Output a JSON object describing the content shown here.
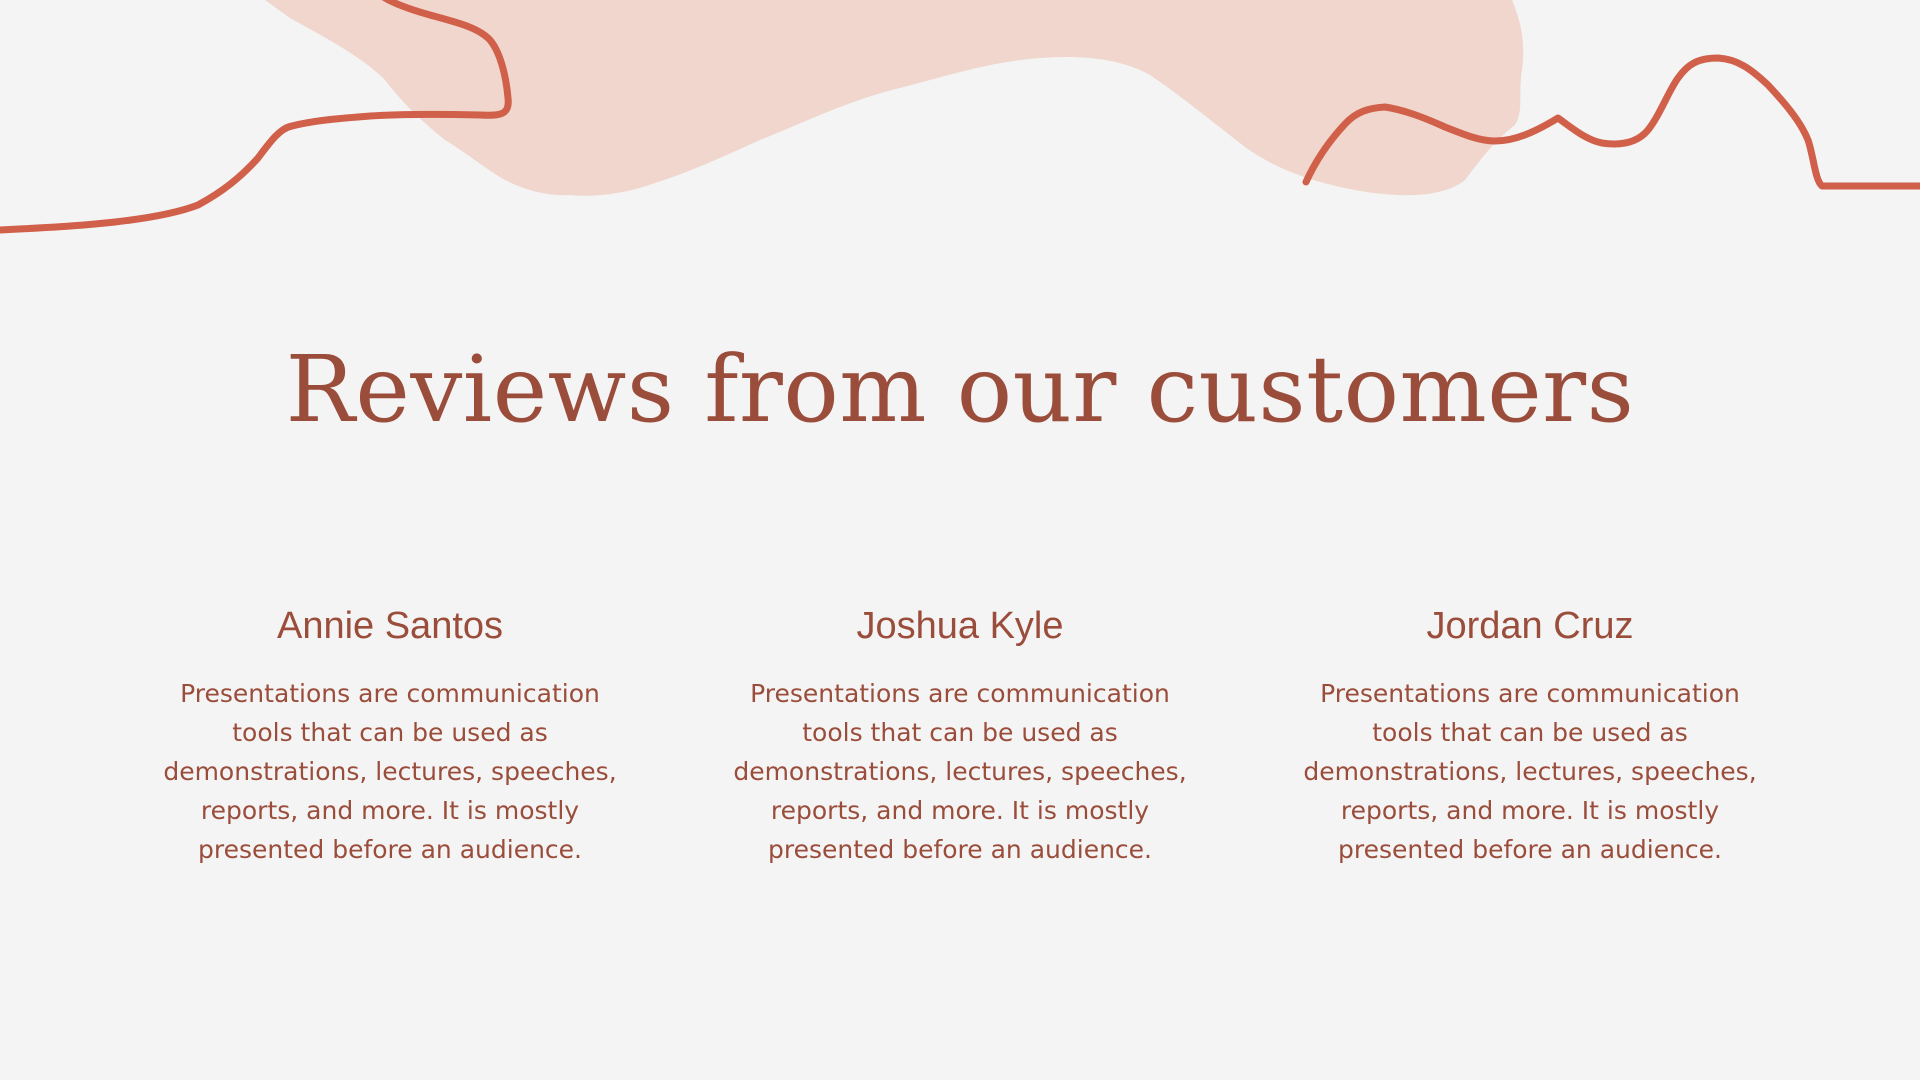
{
  "colors": {
    "background": "#f4f4f4",
    "blob": "#f0d6cc",
    "line": "#d1604a",
    "text": "#9b4d3b"
  },
  "slide": {
    "title": "Reviews from our customers"
  },
  "reviews": [
    {
      "name": "Annie Santos",
      "text": "Presentations are communication tools that can be used as demonstrations, lectures, speeches, reports, and more. It is mostly presented before an audience."
    },
    {
      "name": "Joshua Kyle",
      "text": "Presentations are communication tools that can be used as demonstrations, lectures, speeches, reports, and more. It is mostly presented before an audience."
    },
    {
      "name": "Jordan Cruz",
      "text": "Presentations are communication tools that can be used as demonstrations, lectures, speeches, reports, and more. It is mostly presented before an audience."
    }
  ]
}
